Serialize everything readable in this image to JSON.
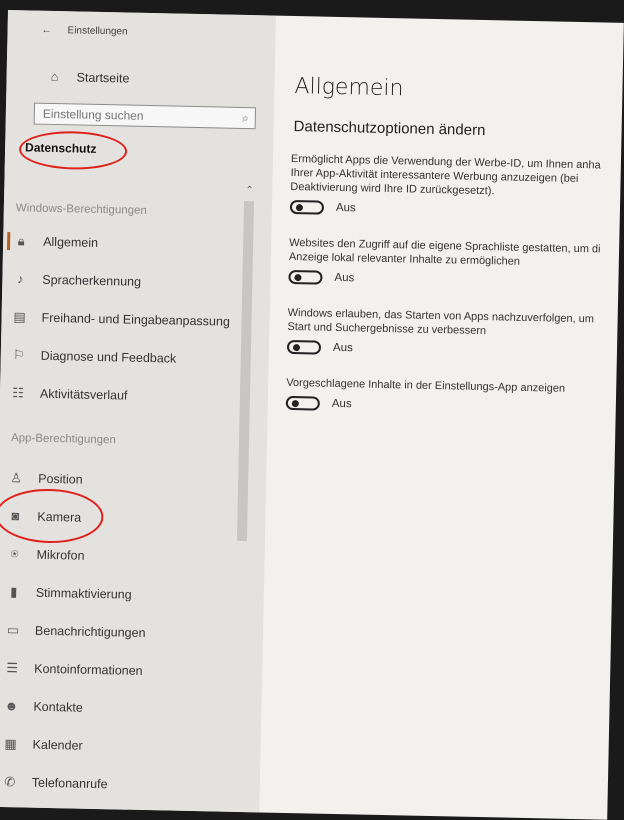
{
  "window": {
    "title": "Einstellungen"
  },
  "sidebar": {
    "home_label": "Startseite",
    "search_placeholder": "Einstellung suchen",
    "section_title": "Datenschutz",
    "group_windows": "Windows-Berechtigungen",
    "windows_items": [
      {
        "label": "Allgemein",
        "icon": "lock-icon"
      },
      {
        "label": "Spracherkennung",
        "icon": "speech-icon"
      },
      {
        "label": "Freihand- und Eingabeanpassung",
        "icon": "clipboard-icon"
      },
      {
        "label": "Diagnose und Feedback",
        "icon": "feedback-icon"
      },
      {
        "label": "Aktivitätsverlauf",
        "icon": "timeline-icon"
      }
    ],
    "group_app": "App-Berechtigungen",
    "app_items": [
      {
        "label": "Position",
        "icon": "location-icon"
      },
      {
        "label": "Kamera",
        "icon": "camera-icon"
      },
      {
        "label": "Mikrofon",
        "icon": "microphone-icon"
      },
      {
        "label": "Stimmaktivierung",
        "icon": "voice-activation-icon"
      },
      {
        "label": "Benachrichtigungen",
        "icon": "notification-icon"
      },
      {
        "label": "Kontoinformationen",
        "icon": "account-info-icon"
      },
      {
        "label": "Kontakte",
        "icon": "contacts-icon"
      },
      {
        "label": "Kalender",
        "icon": "calendar-icon"
      },
      {
        "label": "Telefonanrufe",
        "icon": "phone-icon"
      }
    ]
  },
  "main": {
    "title": "Allgemein",
    "subheading": "Datenschutzoptionen ändern",
    "options": [
      {
        "lines": [
          "Ermöglicht Apps die Verwendung der Werbe-ID, um Ihnen anha",
          "Ihrer App-Aktivität interessantere Werbung anzuzeigen (bei",
          "Deaktivierung wird Ihre ID zurückgesetzt)."
        ],
        "state": "Aus",
        "on": false
      },
      {
        "lines": [
          "Websites den Zugriff auf die eigene Sprachliste gestatten, um di",
          "Anzeige lokal relevanter Inhalte zu ermöglichen"
        ],
        "state": "Aus",
        "on": false
      },
      {
        "lines": [
          "Windows erlauben, das Starten von Apps nachzuverfolgen, um",
          "Start und Suchergebnisse zu verbessern"
        ],
        "state": "Aus",
        "on": false
      },
      {
        "lines": [
          "Vorgeschlagene Inhalte in der Einstellungs-App anzeigen"
        ],
        "state": "Aus",
        "on": false
      }
    ]
  },
  "colors": {
    "annotation": "#e0201a",
    "accent": "#b06020"
  }
}
